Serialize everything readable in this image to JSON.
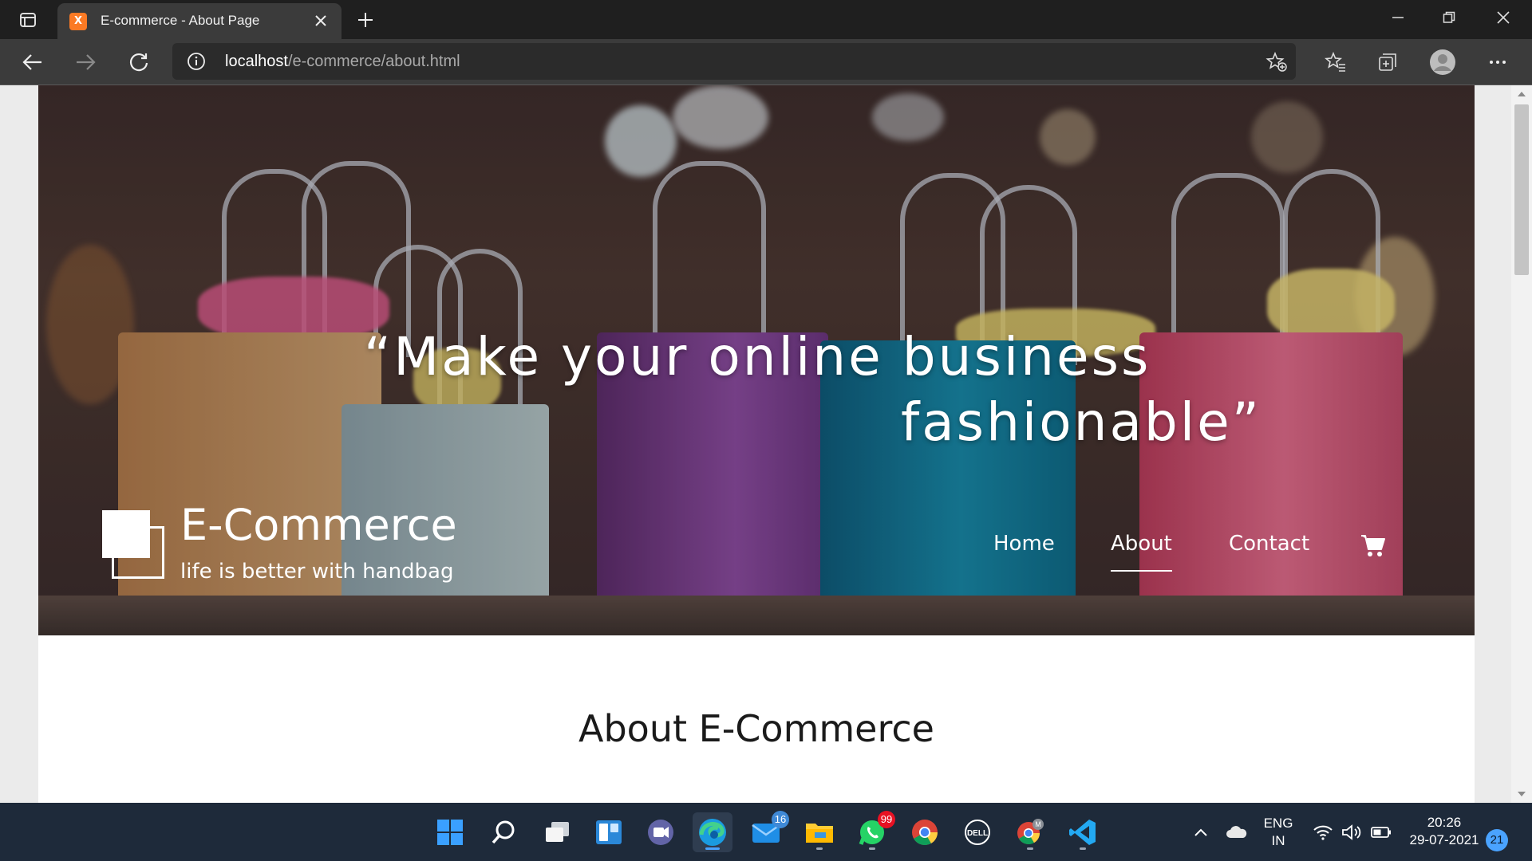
{
  "browser": {
    "tab_title": "E-commerce - About Page",
    "url_host": "localhost",
    "url_path": "/e-commerce/about.html",
    "favicon_label": "X"
  },
  "hero": {
    "quote_line1": "“Make your online business",
    "quote_line2": "fashionable”",
    "brand": "E-Commerce",
    "tagline": "life is better with handbag"
  },
  "nav": {
    "items": [
      {
        "label": "Home",
        "active": false
      },
      {
        "label": "About",
        "active": true
      },
      {
        "label": "Contact",
        "active": false
      }
    ],
    "cart_icon": "shopping-cart-icon"
  },
  "main": {
    "section_title": "About E-Commerce"
  },
  "taskbar": {
    "mail_badge": "16",
    "whatsapp_badge": "99",
    "lang_line1": "ENG",
    "lang_line2": "IN",
    "time": "20:26",
    "date": "29-07-2021",
    "notifications": "21"
  },
  "colors": {
    "taskbar_bg": "#1e2a3a",
    "tab_bg": "#3b3b3b",
    "accent": "#4aa3ff",
    "badge_red": "#e81123"
  }
}
